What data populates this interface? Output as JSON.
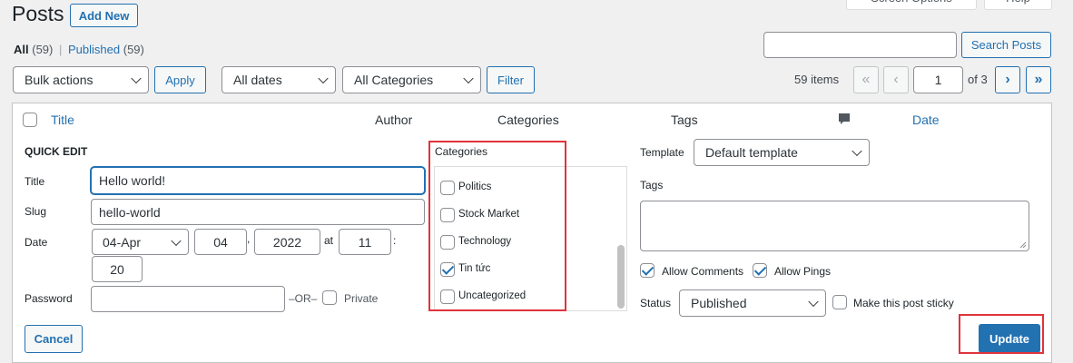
{
  "header": {
    "title": "Posts",
    "add_new": "Add New",
    "screen_options": "Screen Options",
    "help": "Help"
  },
  "views": {
    "all_label": "All",
    "all_count": "(59)",
    "separator": "|",
    "published_label": "Published",
    "published_count": "(59)"
  },
  "search": {
    "value": "",
    "button": "Search Posts"
  },
  "toolbar": {
    "bulk_actions": "Bulk actions",
    "apply": "Apply",
    "dates": "All dates",
    "categories": "All Categories",
    "filter": "Filter"
  },
  "pagination": {
    "items": "59 items",
    "first": "«",
    "prev": "‹",
    "current_page": "1",
    "of": "of 3",
    "next": "›",
    "last": "»"
  },
  "table_header": {
    "title": "Title",
    "author": "Author",
    "categories": "Categories",
    "tags": "Tags",
    "date": "Date"
  },
  "quick_edit": {
    "heading": "QUICK EDIT",
    "title_label": "Title",
    "title_value": "Hello world!",
    "slug_label": "Slug",
    "slug_value": "hello-world",
    "date_label": "Date",
    "month": "04-Apr",
    "day": "04",
    "comma": ",",
    "year": "2022",
    "at": "at",
    "hour": "11",
    "colon": ":",
    "minute": "20",
    "password_label": "Password",
    "password_value": "",
    "or": "–OR–",
    "private": "Private",
    "cancel": "Cancel",
    "categories_label": "Categories",
    "category_list": [
      {
        "name": "Politics",
        "checked": false
      },
      {
        "name": "Stock Market",
        "checked": false
      },
      {
        "name": "Technology",
        "checked": false
      },
      {
        "name": "Tin tức",
        "checked": true
      },
      {
        "name": "Uncategorized",
        "checked": false
      }
    ],
    "template_label": "Template",
    "template_value": "Default template",
    "tags_label": "Tags",
    "tags_value": "",
    "allow_comments": "Allow Comments",
    "allow_comments_checked": true,
    "allow_pings": "Allow Pings",
    "allow_pings_checked": true,
    "status_label": "Status",
    "status_value": "Published",
    "sticky": "Make this post sticky",
    "sticky_checked": false,
    "update": "Update"
  },
  "colors": {
    "accent": "#2271b1",
    "highlight": "#e0333b",
    "background": "#f0f0f1"
  }
}
